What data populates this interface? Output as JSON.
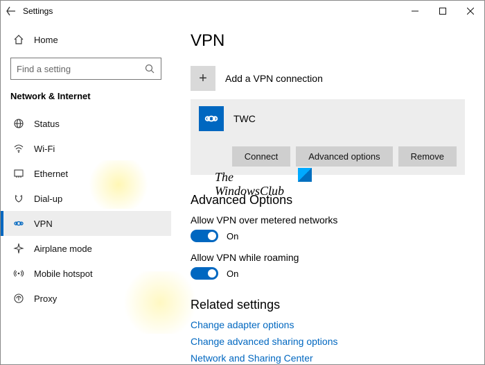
{
  "titlebar": {
    "title": "Settings"
  },
  "sidebar": {
    "home": "Home",
    "searchPlaceholder": "Find a setting",
    "section": "Network & Internet",
    "items": [
      {
        "label": "Status"
      },
      {
        "label": "Wi-Fi"
      },
      {
        "label": "Ethernet"
      },
      {
        "label": "Dial-up"
      },
      {
        "label": "VPN"
      },
      {
        "label": "Airplane mode"
      },
      {
        "label": "Mobile hotspot"
      },
      {
        "label": "Proxy"
      }
    ]
  },
  "main": {
    "title": "VPN",
    "addLabel": "Add a VPN connection",
    "connection": {
      "name": "TWC",
      "buttons": {
        "connect": "Connect",
        "advanced": "Advanced options",
        "remove": "Remove"
      }
    },
    "advanced": {
      "heading": "Advanced Options",
      "opt1": {
        "label": "Allow VPN over metered networks",
        "state": "On"
      },
      "opt2": {
        "label": "Allow VPN while roaming",
        "state": "On"
      }
    },
    "related": {
      "heading": "Related settings",
      "links": [
        "Change adapter options",
        "Change advanced sharing options",
        "Network and Sharing Center"
      ]
    }
  },
  "watermark": {
    "line1": "The",
    "line2": "WindowsClub"
  }
}
